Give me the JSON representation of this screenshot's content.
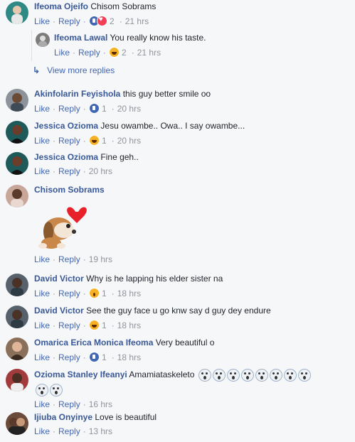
{
  "labels": {
    "like": "Like",
    "reply": "Reply",
    "sep": "·",
    "view_more": "View more replies"
  },
  "comments": [
    {
      "name": "Ifeoma Ojeifo",
      "text": "Chisom Sobrams",
      "reactions": [
        "like",
        "love"
      ],
      "count": "2",
      "time": "21 hrs",
      "avatar_color": "#2f8a86"
    },
    {
      "name": "Ifeoma Lawal",
      "text": "You really know his taste.",
      "reactions": [
        "haha"
      ],
      "count": "2",
      "time": "21 hrs",
      "avatar_color": "#7c7c7c"
    },
    {
      "name": "Akinfolarin Feyishola",
      "text": "this guy better smile oo",
      "reactions": [
        "like"
      ],
      "count": "1",
      "time": "20 hrs",
      "avatar_color": "#8c939b"
    },
    {
      "name": "Jessica Ozioma",
      "text": "Jesu owambe.. Owa.. I say owambe...",
      "reactions": [
        "haha"
      ],
      "count": "1",
      "time": "20 hrs",
      "avatar_color": "#1f5a5a"
    },
    {
      "name": "Jessica Ozioma",
      "text": "Fine geh..",
      "reactions": [],
      "count": "",
      "time": "20 hrs",
      "avatar_color": "#1f5a5a"
    },
    {
      "name": "Chisom Sobrams",
      "text": "",
      "reactions": [],
      "count": "",
      "time": "19 hrs",
      "avatar_color": "#c8a69a"
    },
    {
      "name": "David Victor",
      "text": "Why is he lapping his elder sister na",
      "reactions": [
        "wow"
      ],
      "count": "1",
      "time": "18 hrs",
      "avatar_color": "#56616b"
    },
    {
      "name": "David Victor",
      "text": "See the guy face u go knw say d guy dey endure",
      "reactions": [
        "haha"
      ],
      "count": "1",
      "time": "18 hrs",
      "avatar_color": "#56616b"
    },
    {
      "name": "Omarica Erica Monica Ifeoma",
      "text": "Very beautiful o",
      "reactions": [
        "like"
      ],
      "count": "1",
      "time": "18 hrs",
      "avatar_color": "#8a6f5a"
    },
    {
      "name": "Ozioma Stanley Ifeanyi",
      "text": "Amamiataskeleto",
      "reactions": [],
      "count": "",
      "time": "16 hrs",
      "avatar_color": "#a23b3b"
    },
    {
      "name": "Ijiuba Onyinye",
      "text": "Love is beautiful",
      "reactions": [],
      "count": "",
      "time": "13 hrs",
      "avatar_color": "#6b4b3a"
    }
  ],
  "sticker_icon": "puppy-heart-sticker",
  "scream_emoji_count": 10
}
